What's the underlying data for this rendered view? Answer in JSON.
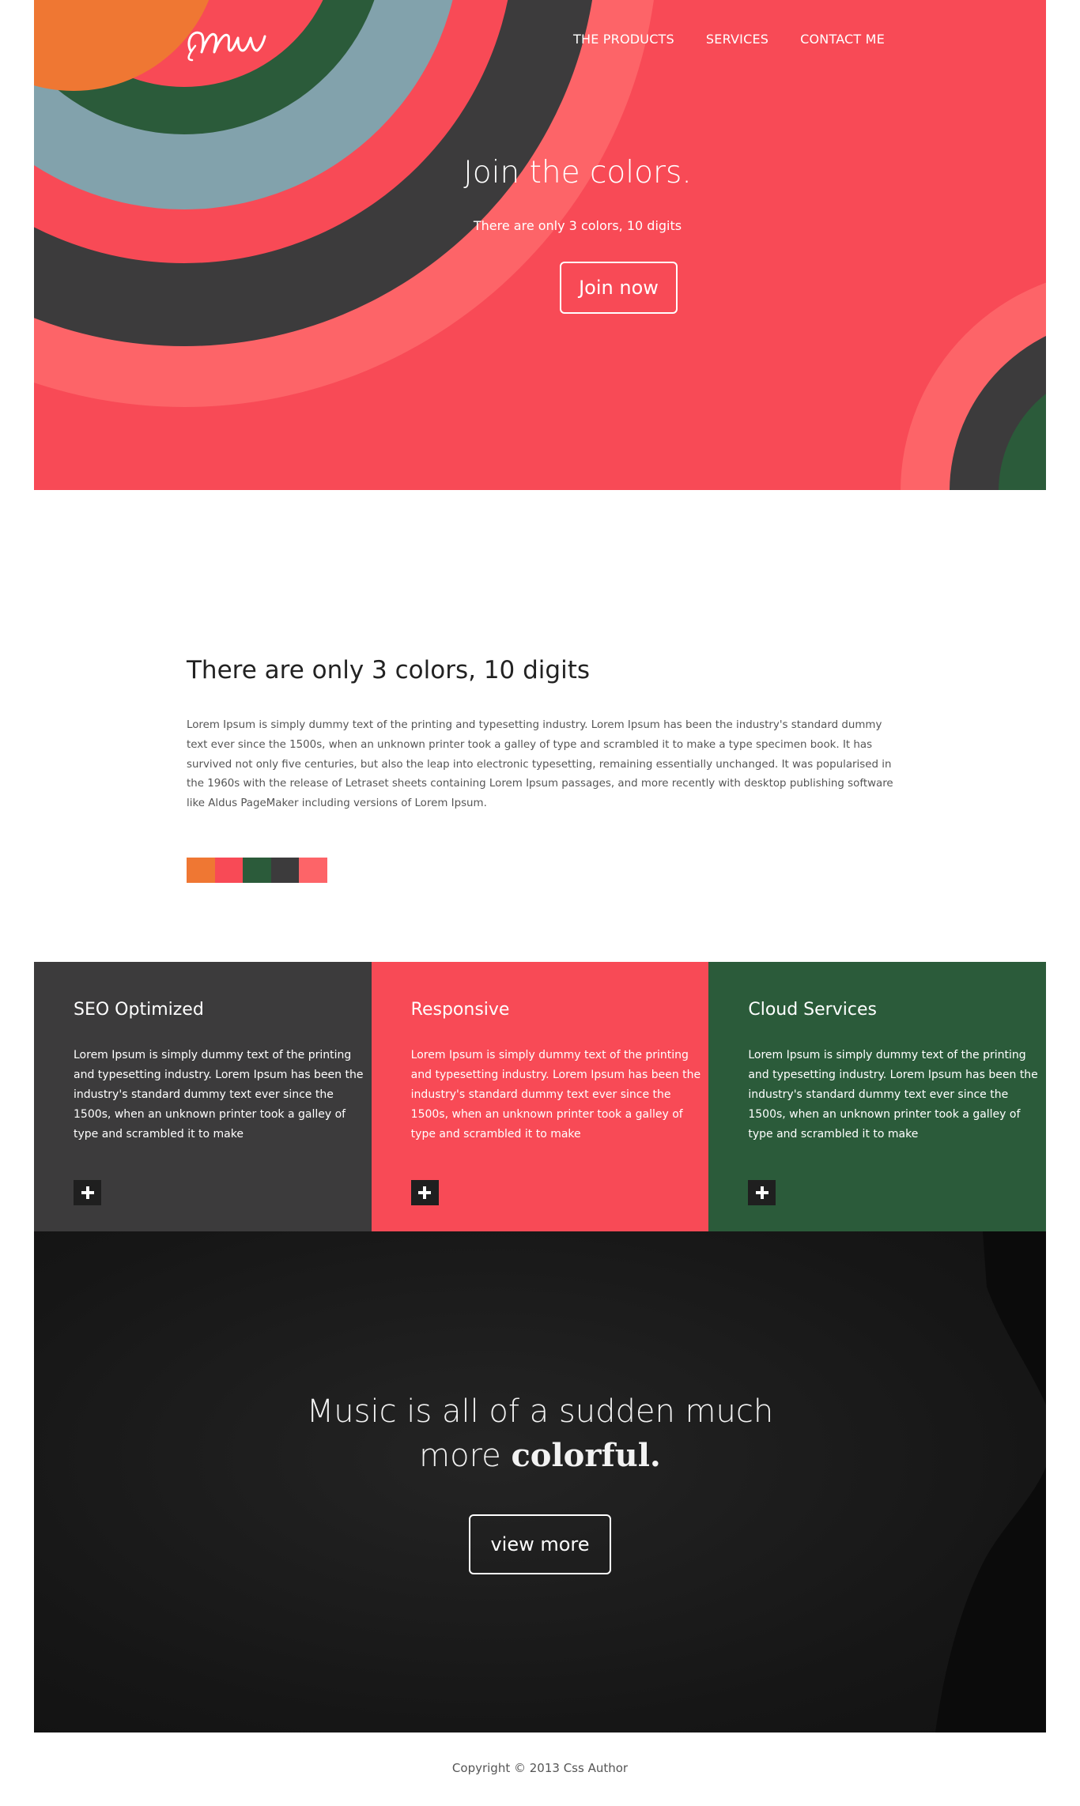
{
  "header": {
    "logo_text": "Mw",
    "nav": [
      "THE PRODUCTS",
      "SERVICES",
      "CONTACT ME"
    ]
  },
  "hero": {
    "title": "Join the colors.",
    "subtitle": "There are only 3 colors, 10 digits",
    "cta_label": "Join now"
  },
  "intro": {
    "title": "There are only 3 colors, 10 digits",
    "body": "Lorem Ipsum is simply dummy text of the printing and typesetting industry. Lorem Ipsum has been the industry's standard dummy text ever since the 1500s, when an unknown printer took a galley of type and scrambled it to make a type specimen book. It has survived not only five centuries, but also the leap into electronic typesetting, remaining essentially unchanged. It was popularised in the 1960s with the release of Letraset sheets containing Lorem Ipsum passages, and more recently with desktop publishing software like Aldus PageMaker including versions of Lorem Ipsum."
  },
  "palette": [
    "#ef7733",
    "#f84a56",
    "#2b5b3a",
    "#3c3b3c",
    "#fd6468"
  ],
  "features": [
    {
      "title": "SEO Optimized",
      "body": "Lorem Ipsum is simply dummy text of the printing and typesetting industry. Lorem Ipsum has been the industry's standard dummy text ever since the 1500s, when an unknown printer took a galley of type and scrambled it to make",
      "color": "#3c3b3c"
    },
    {
      "title": "Responsive",
      "body": "Lorem Ipsum is simply dummy text of the printing and typesetting industry. Lorem Ipsum has been the industry's standard dummy text ever since the 1500s, when an unknown printer took a galley of type and scrambled it to make",
      "color": "#f84a56"
    },
    {
      "title": "Cloud Services",
      "body": "Lorem Ipsum is simply dummy text of the printing and typesetting industry. Lorem Ipsum has been the industry's standard dummy text ever since the 1500s, when an unknown printer took a galley of type and scrambled it to make",
      "color": "#2b5b3a"
    }
  ],
  "music": {
    "title_line1": "Music is all of a sudden much",
    "title_line2_plain": "more ",
    "title_line2_strong": "colorful.",
    "cta_label": "view more"
  },
  "footer": {
    "copyright": "Copyright © 2013 Css Author"
  }
}
